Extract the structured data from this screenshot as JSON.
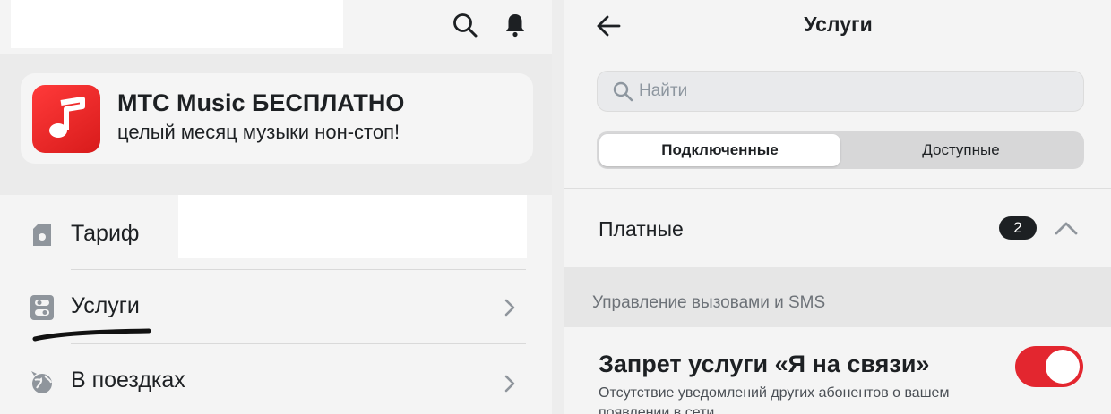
{
  "left": {
    "header_faint_text": "",
    "banner": {
      "title": "МТС Music БЕСПЛАТНО",
      "subtitle": "целый месяц музыки нон-стоп!",
      "icon": "music-note-icon",
      "accent": "#e8262b"
    },
    "menu": {
      "items": [
        {
          "label": "Тариф",
          "icon": "sim-card-icon"
        },
        {
          "label": "Услуги",
          "icon": "services-icon"
        },
        {
          "label": "В поездках",
          "icon": "globe-icon"
        }
      ]
    }
  },
  "right": {
    "title": "Услуги",
    "search": {
      "placeholder": "Найти",
      "value": ""
    },
    "tabs": [
      {
        "label": "Подключенные",
        "active": true
      },
      {
        "label": "Доступные",
        "active": false
      }
    ],
    "paid": {
      "label": "Платные",
      "count": "2",
      "expanded": true
    },
    "section": {
      "label": "Управление вызовами и SMS"
    },
    "service": {
      "title": "Запрет услуги «Я на связи»",
      "description": "Отсутствие уведомлений других абонентов о вашем появлении в сети",
      "enabled": true,
      "toggle_color": "#e3262f"
    }
  }
}
